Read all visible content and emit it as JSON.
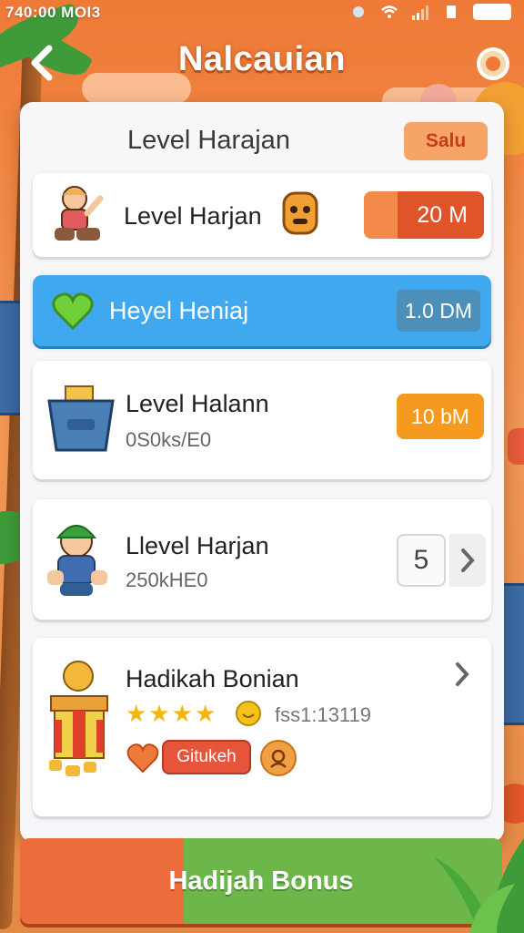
{
  "status_bar": {
    "time": "740:00 MOI3"
  },
  "header": {
    "title": "Nalcauian",
    "back_icon": "chevron-left-icon",
    "settings_icon": "gear-icon"
  },
  "panel": {
    "title": "Level Harajan",
    "chip_label": "Salu"
  },
  "rows": [
    {
      "title": "Level Harjan",
      "amount": "20 M",
      "avatar": "kid-avatar-icon",
      "extra_icon": "toast-character-icon"
    },
    {
      "title": "Heyel Heniaj",
      "amount": "1.0 DM",
      "icon": "heart-icon"
    },
    {
      "title": "Level Halann",
      "subtitle": "0S0ks/E0",
      "amount": "10 bM",
      "icon": "basket-icon"
    },
    {
      "title": "Llevel Harjan",
      "subtitle": "250kHE0",
      "level": "5",
      "avatar": "worker-avatar-icon"
    },
    {
      "title": "Hadikah Bonian",
      "rating": 4,
      "timer": "fss1:13119",
      "claim_label": "Gitukeh",
      "icon": "gift-box-icon"
    }
  ],
  "bottom_button": {
    "label": "Hadijah Bonus"
  },
  "colors": {
    "background": "#ef7a37",
    "panel": "#f7f7f9",
    "blue_row": "#3fa8ee",
    "gold": "#f59a1e",
    "green": "#6cb64a",
    "orange": "#ec6d3b"
  }
}
